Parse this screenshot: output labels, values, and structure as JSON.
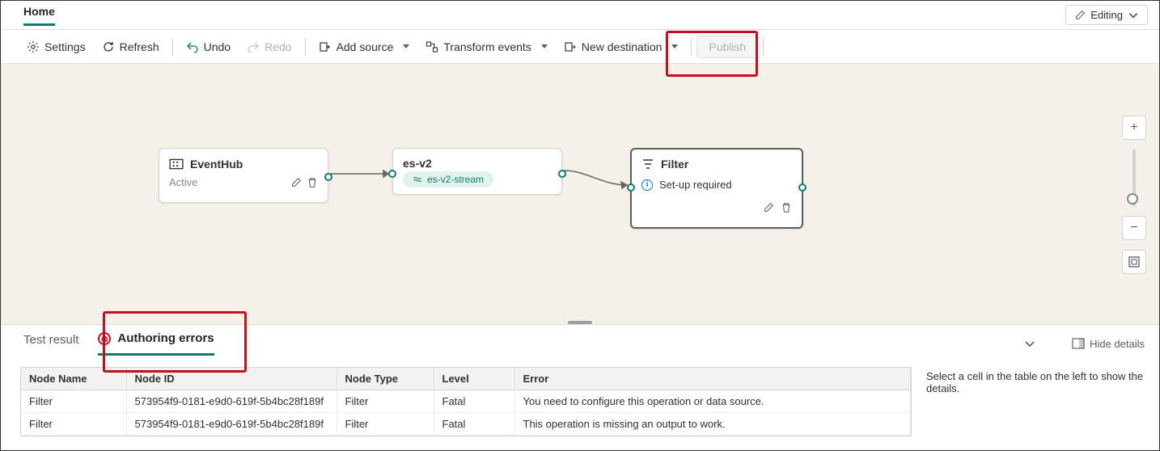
{
  "top": {
    "home_label": "Home",
    "editing_label": "Editing"
  },
  "toolbar": {
    "settings": "Settings",
    "refresh": "Refresh",
    "undo": "Undo",
    "redo": "Redo",
    "add_source": "Add source",
    "transform_events": "Transform events",
    "new_destination": "New destination",
    "publish": "Publish"
  },
  "nodes": {
    "eventhub": {
      "title": "EventHub",
      "status": "Active"
    },
    "stream": {
      "title": "es-v2",
      "pill": "es-v2-stream"
    },
    "filter": {
      "title": "Filter",
      "status": "Set-up required"
    }
  },
  "tabs": {
    "test_result": "Test result",
    "authoring_errors": "Authoring errors",
    "hide_details": "Hide details"
  },
  "table": {
    "headers": {
      "node_name": "Node Name",
      "node_id": "Node ID",
      "node_type": "Node Type",
      "level": "Level",
      "error": "Error"
    },
    "rows": [
      {
        "node_name": "Filter",
        "node_id": "573954f9-0181-e9d0-619f-5b4bc28f189f",
        "node_type": "Filter",
        "level": "Fatal",
        "error": "You need to configure this operation or data source."
      },
      {
        "node_name": "Filter",
        "node_id": "573954f9-0181-e9d0-619f-5b4bc28f189f",
        "node_type": "Filter",
        "level": "Fatal",
        "error": "This operation is missing an output to work."
      }
    ]
  },
  "detail_panel": "Select a cell in the table on the left to show the details."
}
